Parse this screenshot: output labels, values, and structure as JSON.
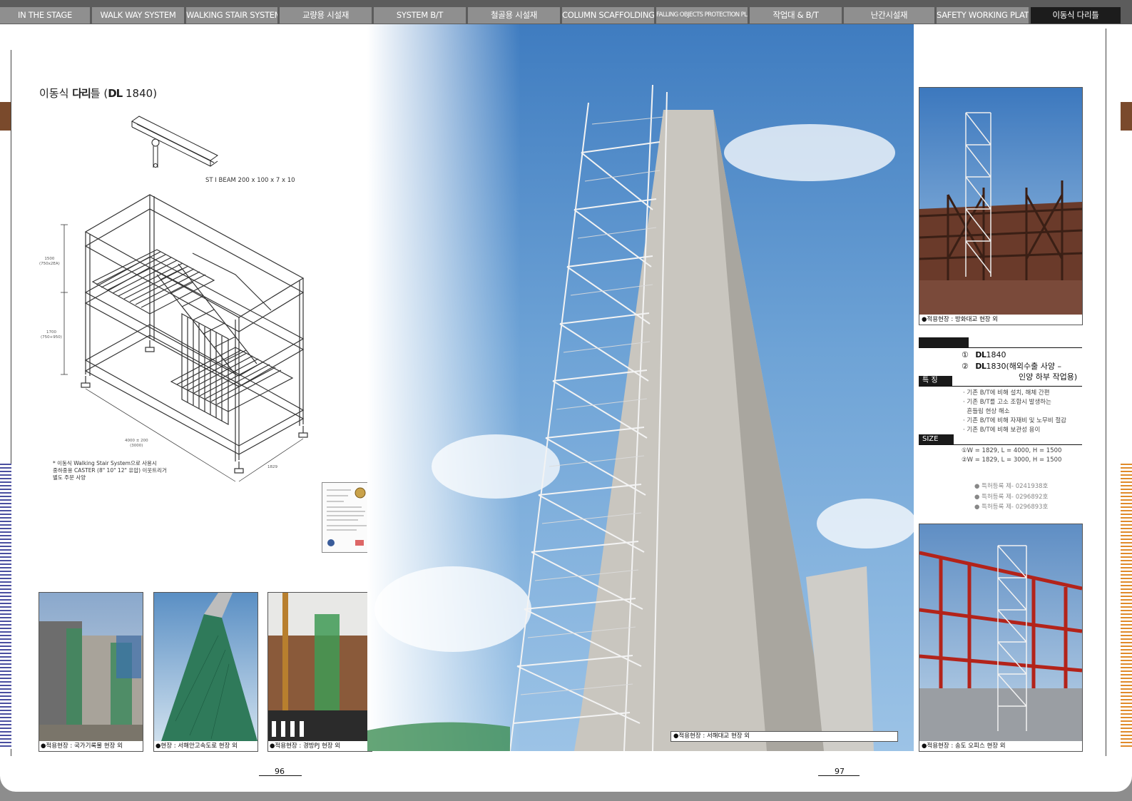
{
  "nav": {
    "tabs": [
      {
        "label": "IN THE STAGE",
        "w": 126,
        "active": false,
        "narrow": false
      },
      {
        "label": "WALK WAY SYSTEM",
        "w": 129,
        "active": false,
        "narrow": false
      },
      {
        "label": "WALKING STAIR SYSTEM",
        "w": 128,
        "active": false,
        "narrow": false
      },
      {
        "label": "교량용 시설재",
        "w": 129,
        "active": false,
        "narrow": false
      },
      {
        "label": "SYSTEM B/T",
        "w": 129,
        "active": false,
        "narrow": false
      },
      {
        "label": "철골용 시설재",
        "w": 129,
        "active": false,
        "narrow": false
      },
      {
        "label": "COLUMN SCAFFOLDING",
        "w": 129,
        "active": false,
        "narrow": false
      },
      {
        "label": "FALLING OBJECTS PROTECTION PLATFORM",
        "w": 128,
        "active": false,
        "narrow": true
      },
      {
        "label": "작업대 & B/T",
        "w": 129,
        "active": false,
        "narrow": false
      },
      {
        "label": "난간시설재",
        "w": 127,
        "active": false,
        "narrow": false
      },
      {
        "label": "SAFETY WORKING PLATFORM",
        "w": 129,
        "active": false,
        "narrow": false
      },
      {
        "label": "이동식 다리틀",
        "w": 126,
        "active": true,
        "narrow": false
      }
    ]
  },
  "left_page": {
    "title_prefix": "이동식",
    "title_brand": "다리",
    "title_suffix": "틀 (",
    "title_model_brand": "DL",
    "title_model_number": "1840)",
    "beam_label": "ST Ⅰ BEAM 200 x 100 x 7 x 10",
    "dims": {
      "h1": "1500",
      "h1_sub": "(750x2EA)",
      "h2": "1700",
      "h2_sub": "(750+950)",
      "length": "4000 ± 200",
      "length_sub": "(3000)",
      "width": "1829"
    },
    "note_line1": "* 이동식 Walking Stair System으로 사용시",
    "note_line2": "중하중용 CASTER (8\" 10\" 12\" 유압) 이웃트리거",
    "note_line3": "별도 주문 사양",
    "thumbs": [
      {
        "caption": "●적용현장 : 국가기록물 현장 외"
      },
      {
        "caption": "●현장 : 서해안고속도로 현장 외"
      },
      {
        "caption": "●적용현장 : 경방PJ 현장 외"
      }
    ],
    "page_number": "96"
  },
  "big_photo": {
    "caption": "●적용현장 : 서해대교 현장 외"
  },
  "right_page": {
    "top_photo_caption": "●적용현장 : 방화대교 현장 외",
    "models": [
      {
        "num": "①",
        "brand": "DL",
        "model": "1840",
        "extra": ""
      },
      {
        "num": "②",
        "brand": "DL",
        "model": "1830",
        "extra": "(해외수출 사양 –"
      }
    ],
    "model2_extra_line2": "인양 하부 작업용)",
    "features_tag": "특  징",
    "features": [
      "· 기존 B/T에 비해 설치, 해체 간편",
      "· 기존 B/T를 고소 조합시 발생하는",
      "  흔들림 현상 해소",
      "· 기존 B/T에 비해 자재비 및 노무비 절감",
      "· 기존 B/T에 비해 보관성 용이"
    ],
    "size_tag": "SIZE",
    "sizes": [
      "①W = 1829, L = 4000, H = 1500",
      "②W = 1829, L = 3000, H = 1500"
    ],
    "patents": [
      "● 특허등록 제- 0241938호",
      "● 특허등록 제- 0296892호",
      "● 특허등록 제- 0296893호"
    ],
    "bottom_photo_caption": "●적용현장 : 송도 오피스 현장 외",
    "page_number": "97"
  }
}
